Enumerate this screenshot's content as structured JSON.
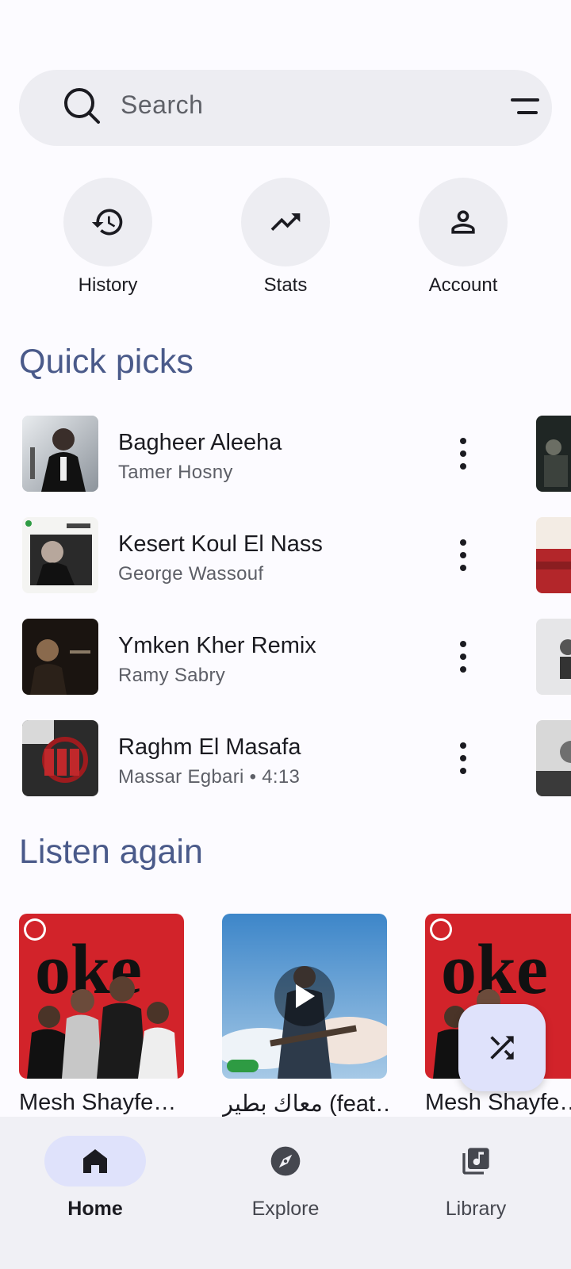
{
  "search": {
    "placeholder": "Search",
    "icon": "search-icon",
    "filter_icon": "filter-icon"
  },
  "quick_actions": [
    {
      "label": "History",
      "icon": "history-icon"
    },
    {
      "label": "Stats",
      "icon": "trending-up-icon"
    },
    {
      "label": "Account",
      "icon": "person-icon"
    }
  ],
  "quick_picks": {
    "title": "Quick picks",
    "items": [
      {
        "title": "Bagheer Aleeha",
        "subtitle": "Tamer Hosny"
      },
      {
        "title": "Kesert Koul El Nass",
        "subtitle": "George Wassouf"
      },
      {
        "title": "Ymken Kher Remix",
        "subtitle": "Ramy Sabry"
      },
      {
        "title": "Raghm El Masafa",
        "subtitle": "Massar Egbari • 4:13"
      }
    ]
  },
  "listen_again": {
    "title": "Listen again",
    "items": [
      {
        "title": "Mesh Shayfe…"
      },
      {
        "title": "معاك بطير (feat…"
      },
      {
        "title": "Mesh Shayfe…"
      }
    ]
  },
  "fab": {
    "icon": "shuffle-icon"
  },
  "nav": [
    {
      "label": "Home",
      "icon": "home-icon",
      "active": true
    },
    {
      "label": "Explore",
      "icon": "explore-icon",
      "active": false
    },
    {
      "label": "Library",
      "icon": "library-music-icon",
      "active": false
    }
  ],
  "colors": {
    "accent": "#4a5a8a",
    "surface": "#ededf2",
    "active_pill": "#dfe2fb"
  }
}
